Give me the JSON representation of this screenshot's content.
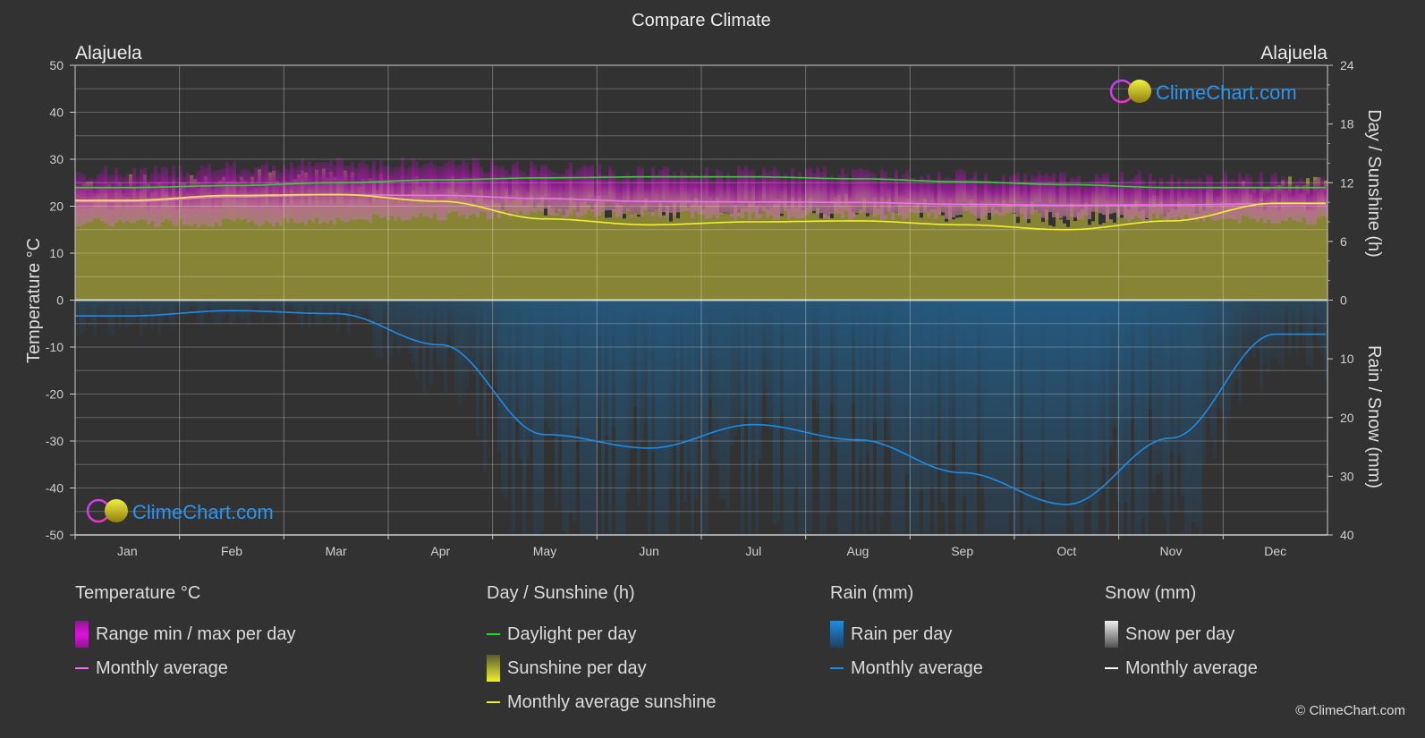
{
  "chart_data": {
    "type": "area",
    "title": "Compare Climate",
    "location_left": "Alajuela",
    "location_right": "Alajuela",
    "categories": [
      "Jan",
      "Feb",
      "Mar",
      "Apr",
      "May",
      "Jun",
      "Jul",
      "Aug",
      "Sep",
      "Oct",
      "Nov",
      "Dec"
    ],
    "y_left": {
      "label": "Temperature °C",
      "range": [
        -50,
        50
      ],
      "ticks": [
        50,
        40,
        30,
        20,
        10,
        0,
        -10,
        -20,
        -30,
        -40,
        -50
      ]
    },
    "y_right_top": {
      "label": "Day / Sunshine (h)",
      "range": [
        0,
        24
      ],
      "ticks": [
        24,
        18,
        12,
        6,
        0
      ]
    },
    "y_right_bottom": {
      "label": "Rain / Snow (mm)",
      "range": [
        0,
        40
      ],
      "ticks": [
        0,
        10,
        20,
        30,
        40
      ]
    },
    "grid": true,
    "series": [
      {
        "name": "Temperature monthly average",
        "unit": "°C",
        "color": "#f070f0",
        "values": [
          21.0,
          22.0,
          22.4,
          22.3,
          21.6,
          21.0,
          20.9,
          20.8,
          20.4,
          20.2,
          20.3,
          20.5
        ]
      },
      {
        "name": "Temperature max per day (typical)",
        "unit": "°C",
        "values": [
          26.5,
          27.5,
          28.5,
          28.5,
          27.5,
          26.5,
          26.5,
          26.5,
          26.0,
          25.5,
          25.5,
          25.5
        ]
      },
      {
        "name": "Temperature min per day (typical)",
        "unit": "°C",
        "values": [
          16.5,
          16.5,
          17.0,
          18.0,
          18.5,
          18.5,
          18.0,
          18.0,
          18.0,
          18.0,
          17.5,
          17.0
        ]
      },
      {
        "name": "Daylight per day",
        "unit": "h",
        "color": "#22dd22",
        "values": [
          11.5,
          11.7,
          12.0,
          12.3,
          12.5,
          12.6,
          12.6,
          12.4,
          12.1,
          11.8,
          11.5,
          11.5
        ]
      },
      {
        "name": "Monthly average sunshine",
        "unit": "h",
        "color": "#f0f030",
        "values": [
          10.2,
          10.7,
          10.8,
          10.1,
          8.3,
          7.7,
          8.0,
          8.1,
          7.7,
          7.2,
          8.1,
          9.9
        ]
      },
      {
        "name": "Rain monthly average",
        "unit": "mm",
        "color": "#1e8ce6",
        "values": [
          2.7,
          1.8,
          2.3,
          7.6,
          22.9,
          25.2,
          21.2,
          23.8,
          29.4,
          34.8,
          23.5,
          5.8
        ]
      },
      {
        "name": "Snow monthly average",
        "unit": "mm",
        "color": "#ffffff",
        "values": [
          0,
          0,
          0,
          0,
          0,
          0,
          0,
          0,
          0,
          0,
          0,
          0
        ]
      }
    ],
    "legend_placement": "bottom"
  },
  "legend": {
    "groups": [
      {
        "title": "Temperature °C",
        "items": [
          {
            "kind": "box",
            "label": "Range min / max per day",
            "color": "#e010e0"
          },
          {
            "kind": "line",
            "label": "Monthly average",
            "color": "#f070f0"
          }
        ]
      },
      {
        "title": "Day / Sunshine (h)",
        "items": [
          {
            "kind": "line",
            "label": "Daylight per day",
            "color": "#22dd22"
          },
          {
            "kind": "box",
            "label": "Sunshine per day",
            "color": "#e8e830"
          },
          {
            "kind": "line",
            "label": "Monthly average sunshine",
            "color": "#f0f030"
          }
        ]
      },
      {
        "title": "Rain (mm)",
        "items": [
          {
            "kind": "box",
            "label": "Rain per day",
            "color": "#1e8ce6"
          },
          {
            "kind": "line",
            "label": "Monthly average",
            "color": "#1e8ce6"
          }
        ]
      },
      {
        "title": "Snow (mm)",
        "items": [
          {
            "kind": "box",
            "label": "Snow per day",
            "color": "#e0e0e0"
          },
          {
            "kind": "line",
            "label": "Monthly average",
            "color": "#ffffff"
          }
        ]
      }
    ]
  },
  "watermark": "ClimeChart.com",
  "copyright": "© ClimeChart.com"
}
